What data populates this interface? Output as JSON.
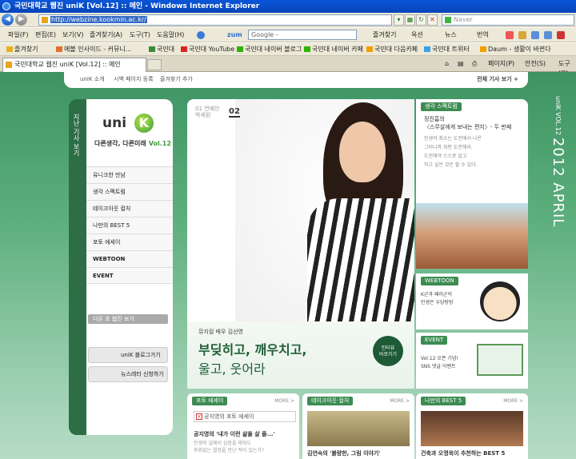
{
  "window": {
    "title": "국민대학교 웹진 uniK [Vol.12] :: 메인 - Windows Internet Explorer"
  },
  "address": {
    "url": "http://webzine.kookmin.ac.kr/",
    "search_placeholder": "Naver"
  },
  "menu": {
    "items": [
      "파일(F)",
      "편집(E)",
      "보기(V)",
      "즐겨찾기(A)",
      "도구(T)",
      "도움말(H)"
    ],
    "zum": "zum",
    "google_placeholder": "Google -",
    "favorites": "즐겨찾기",
    "shopping": "옥션",
    "news": "뉴스",
    "translate": "번역"
  },
  "favorites_bar": {
    "label": "즐겨찾기",
    "items": [
      "에볼 인사이드 - 커뮤니...",
      "국민대",
      "국민대 YouTube",
      "국민대 네이버 블로그",
      "국민대 네이버 카페",
      "국민대 다음카페",
      "국민대 트위터",
      "Daum - 생활이 바뀐다"
    ]
  },
  "tabs": {
    "active": "국민대학교 웹진 uniK [Vol.12] :: 메인",
    "page_menu": "페이지(P)",
    "safety_menu": "안전(S)",
    "tools_menu": "도구(O)"
  },
  "site": {
    "top_links": [
      "uniK 소개",
      "시백 페이지 등록",
      "즐겨찾기 추가"
    ],
    "all_articles": "전체 기사 보기  +",
    "side_tab": "지난 기사 보기",
    "logo_text": "uni",
    "logo_k": "K",
    "tagline": "다른생각, 다른미래",
    "volume": "Vol.12",
    "menu": [
      "유니크한 만남",
      "생각 스펙트럼",
      "테이크아웃 컬처",
      "나만의 BEST 5",
      "포토 에세이",
      "WEBTOON",
      "EVENT"
    ],
    "prev_issue": "다른 호 웹진 보기",
    "blog_btn": "uniK 블로그가기",
    "newsletter_btn": "뉴스레터 신청하기"
  },
  "feature": {
    "issue_label_1": "01  연예인",
    "issue_label_2": "박세원",
    "issue_number": "02",
    "caption_small": "뮤지컬 배우 김선영",
    "caption_line1": "부딪히고, 깨우치고,",
    "caption_line2": "울고, 웃어라",
    "badge_line1": "인터뷰",
    "badge_line2": "바로가기"
  },
  "cards": {
    "spectrum": {
      "tag": "생각 스펙트럼",
      "title1": "정진흠의",
      "title2": "〈스무살에게 보내는 편지〉- 두 번째",
      "body": [
        "인생의 최소는 도전에서 나온",
        "그러니까 좌판 도전해라.",
        "도전해야 스스로 알고",
        "하고 싶은 것은 할 수 있다."
      ]
    },
    "webtoon": {
      "tag": "WEBTOON",
      "body1": "K군과 패러군의",
      "body2": "인생은 우당탕탕"
    },
    "event": {
      "tag": "EVENT",
      "body1": "Vol.12 오픈 기념!",
      "body2": "SNS 댓글 이벤트"
    }
  },
  "bottom": {
    "photo": {
      "tag": "포토 에세이",
      "more": "MORE >",
      "img_alt": "공지영의 포토 에세이",
      "title": "공지영의 '내가 이런 삶을 살 줄...'",
      "body1": "인생의 길에서 심장을 태워도",
      "body2": "후회없는 열정을 만난 적이 있는가?"
    },
    "takeout": {
      "tag": "테이크아웃 컬처",
      "more": "MORE >",
      "title": "김연숙의 '불량한, 그림 이야기'"
    },
    "best5": {
      "tag": "나만의 BEST 5",
      "more": "MORE >",
      "title": "건축과 오명욱이 추천하는 BEST 5"
    }
  },
  "vertical_title": {
    "small": "uniK VOL.12",
    "large": "2012 APRIL"
  },
  "colors": {
    "accent": "#3c8c52",
    "dark_green": "#1f5e36",
    "ie_blue": "#0a56d8"
  }
}
